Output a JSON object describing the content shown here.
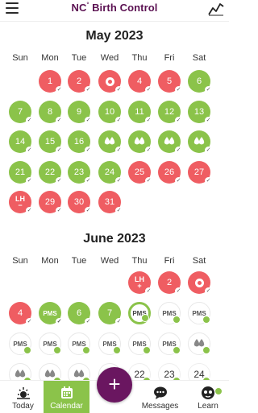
{
  "app": {
    "brand": "NC",
    "brand_mark": "°",
    "brand_suffix": " Birth Control"
  },
  "colors": {
    "red": "#ef5d62",
    "green": "#8bc34a",
    "purple": "#6a1660"
  },
  "weekdays": [
    "Sun",
    "Mon",
    "Tue",
    "Wed",
    "Thu",
    "Fri",
    "Sat"
  ],
  "may": {
    "title": "May 2023",
    "days": [
      {
        "label": "1",
        "type": "red",
        "check": true
      },
      {
        "label": "2",
        "type": "red",
        "check": true
      },
      {
        "label": "",
        "type": "red",
        "icon": "ovulation-ring",
        "check": true
      },
      {
        "label": "4",
        "type": "red",
        "check": true
      },
      {
        "label": "5",
        "type": "red",
        "check": true
      },
      {
        "label": "6",
        "type": "green",
        "check": true
      },
      {
        "label": "7",
        "type": "green",
        "check": true
      },
      {
        "label": "8",
        "type": "green",
        "check": true
      },
      {
        "label": "9",
        "type": "green",
        "check": true
      },
      {
        "label": "10",
        "type": "green",
        "check": true
      },
      {
        "label": "11",
        "type": "green",
        "check": true
      },
      {
        "label": "12",
        "type": "green",
        "check": true
      },
      {
        "label": "13",
        "type": "green",
        "check": true
      },
      {
        "label": "14",
        "type": "green",
        "check": true
      },
      {
        "label": "15",
        "type": "green",
        "check": true
      },
      {
        "label": "16",
        "type": "green",
        "check": true
      },
      {
        "label": "",
        "type": "green",
        "icon": "drops-icon",
        "check": true
      },
      {
        "label": "",
        "type": "green",
        "icon": "drops-icon",
        "check": true
      },
      {
        "label": "",
        "type": "green",
        "icon": "drops-icon",
        "check": true
      },
      {
        "label": "",
        "type": "green",
        "icon": "drops-icon",
        "check": true
      },
      {
        "label": "21",
        "type": "green",
        "check": true
      },
      {
        "label": "22",
        "type": "green",
        "check": true
      },
      {
        "label": "23",
        "type": "green",
        "check": true
      },
      {
        "label": "24",
        "type": "green",
        "check": true
      },
      {
        "label": "25",
        "type": "red",
        "check": true
      },
      {
        "label": "26",
        "type": "red",
        "check": true
      },
      {
        "label": "27",
        "type": "red",
        "check": true
      },
      {
        "label": "LH",
        "type": "red",
        "icon": "lh-negative",
        "check": true
      },
      {
        "label": "29",
        "type": "red",
        "check": true
      },
      {
        "label": "30",
        "type": "red",
        "check": true
      },
      {
        "label": "31",
        "type": "red",
        "check": true
      }
    ]
  },
  "june": {
    "title": "June 2023",
    "days": [
      {
        "label": "LH",
        "type": "red",
        "icon": "lh-positive",
        "check": true
      },
      {
        "label": "2",
        "type": "red",
        "check": true
      },
      {
        "label": "",
        "type": "red",
        "icon": "ovulation-ring",
        "check": true
      },
      {
        "label": "4",
        "type": "red",
        "check": true
      },
      {
        "label": "PMS",
        "type": "green",
        "check": true
      },
      {
        "label": "6",
        "type": "green",
        "check": true
      },
      {
        "label": "7",
        "type": "green",
        "check": true
      },
      {
        "label": "PMS",
        "type": "pms-today"
      },
      {
        "label": "PMS",
        "type": "pms"
      },
      {
        "label": "PMS",
        "type": "pms"
      },
      {
        "label": "PMS",
        "type": "pms"
      },
      {
        "label": "PMS",
        "type": "pms"
      },
      {
        "label": "PMS",
        "type": "pms"
      },
      {
        "label": "PMS",
        "type": "pms"
      },
      {
        "label": "PMS",
        "type": "pms"
      },
      {
        "label": "PMS",
        "type": "pms"
      },
      {
        "label": "",
        "type": "pms",
        "icon": "drop-icon"
      },
      {
        "label": "",
        "type": "pms",
        "icon": "drop-icon"
      },
      {
        "label": "",
        "type": "pms",
        "icon": "drop-icon"
      },
      {
        "label": "",
        "type": "pms",
        "icon": "drop-icon"
      },
      {
        "label": "",
        "type": "pms",
        "icon": "drop-icon"
      },
      {
        "label": "22",
        "type": "plain"
      },
      {
        "label": "23",
        "type": "plain"
      },
      {
        "label": "24",
        "type": "plain"
      }
    ]
  },
  "nav": {
    "items": [
      {
        "label": "Today",
        "icon": "sun-icon"
      },
      {
        "label": "Calendar",
        "icon": "calendar-icon",
        "active": true
      },
      {
        "label": "",
        "icon": "add-icon"
      },
      {
        "label": "Messages",
        "icon": "chat-icon"
      },
      {
        "label": "Learn",
        "icon": "learn-icon"
      }
    ],
    "fab_label": "+"
  }
}
